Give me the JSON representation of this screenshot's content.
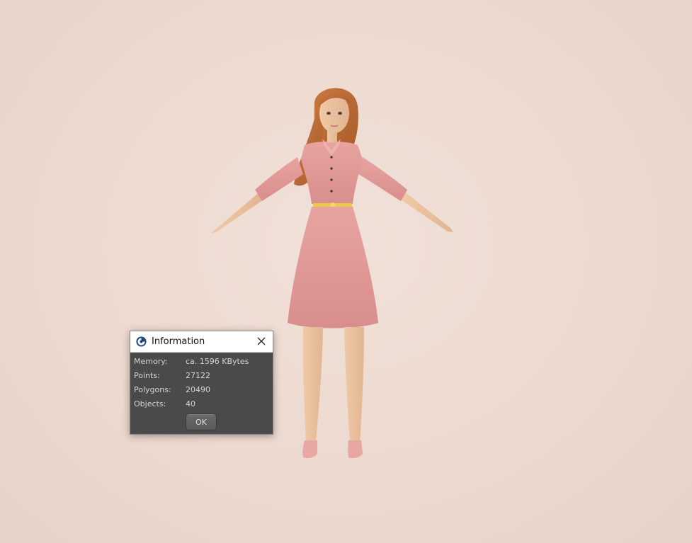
{
  "scene": {
    "background_color": "#ecd9cf",
    "subject": "figure-icon"
  },
  "dialog": {
    "title": "Information",
    "app_icon": "cinema4d-logo-icon",
    "close_icon": "close-icon",
    "rows": [
      {
        "label": "Memory:",
        "value": "ca. 1596 KBytes"
      },
      {
        "label": "Points:",
        "value": "27122"
      },
      {
        "label": "Polygons:",
        "value": "20490"
      },
      {
        "label": "Objects:",
        "value": "40"
      }
    ],
    "ok_label": "OK"
  }
}
